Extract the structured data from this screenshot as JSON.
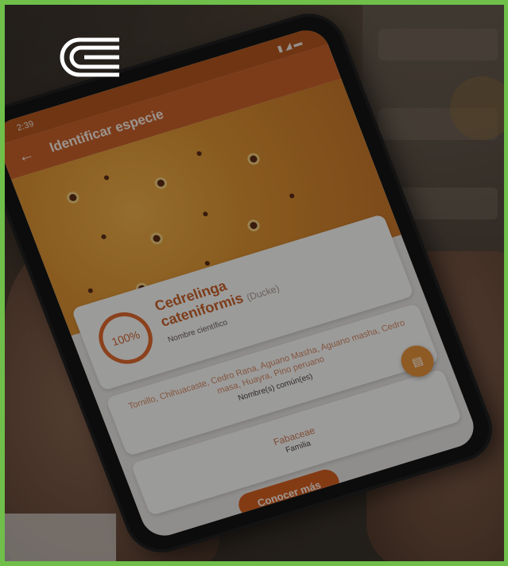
{
  "status": {
    "time": "2:39"
  },
  "appbar": {
    "title": "Identificar especie"
  },
  "result": {
    "confidence": "100%",
    "scientific_name_line1": "Cedrelinga",
    "scientific_name_line2": "cateniformis",
    "author": "(Ducke)",
    "scientific_label": "Nombre científico",
    "common_names": "Tornillo, Chihuacaste, Cedro Rana, Aguano Masha, Aguano masha, Cedro masa, Huayra, Pino peruano",
    "common_label": "Nombre(s) común(es)",
    "family": "Fabaceae",
    "family_label": "Familia",
    "cta_label": "Conocer más"
  },
  "colors": {
    "frame_border": "#6fbf4a",
    "accent": "#c9622a",
    "cta": "#d35f21"
  },
  "icons": [
    "back-arrow-icon",
    "document-icon",
    "logo-mark-icon"
  ]
}
